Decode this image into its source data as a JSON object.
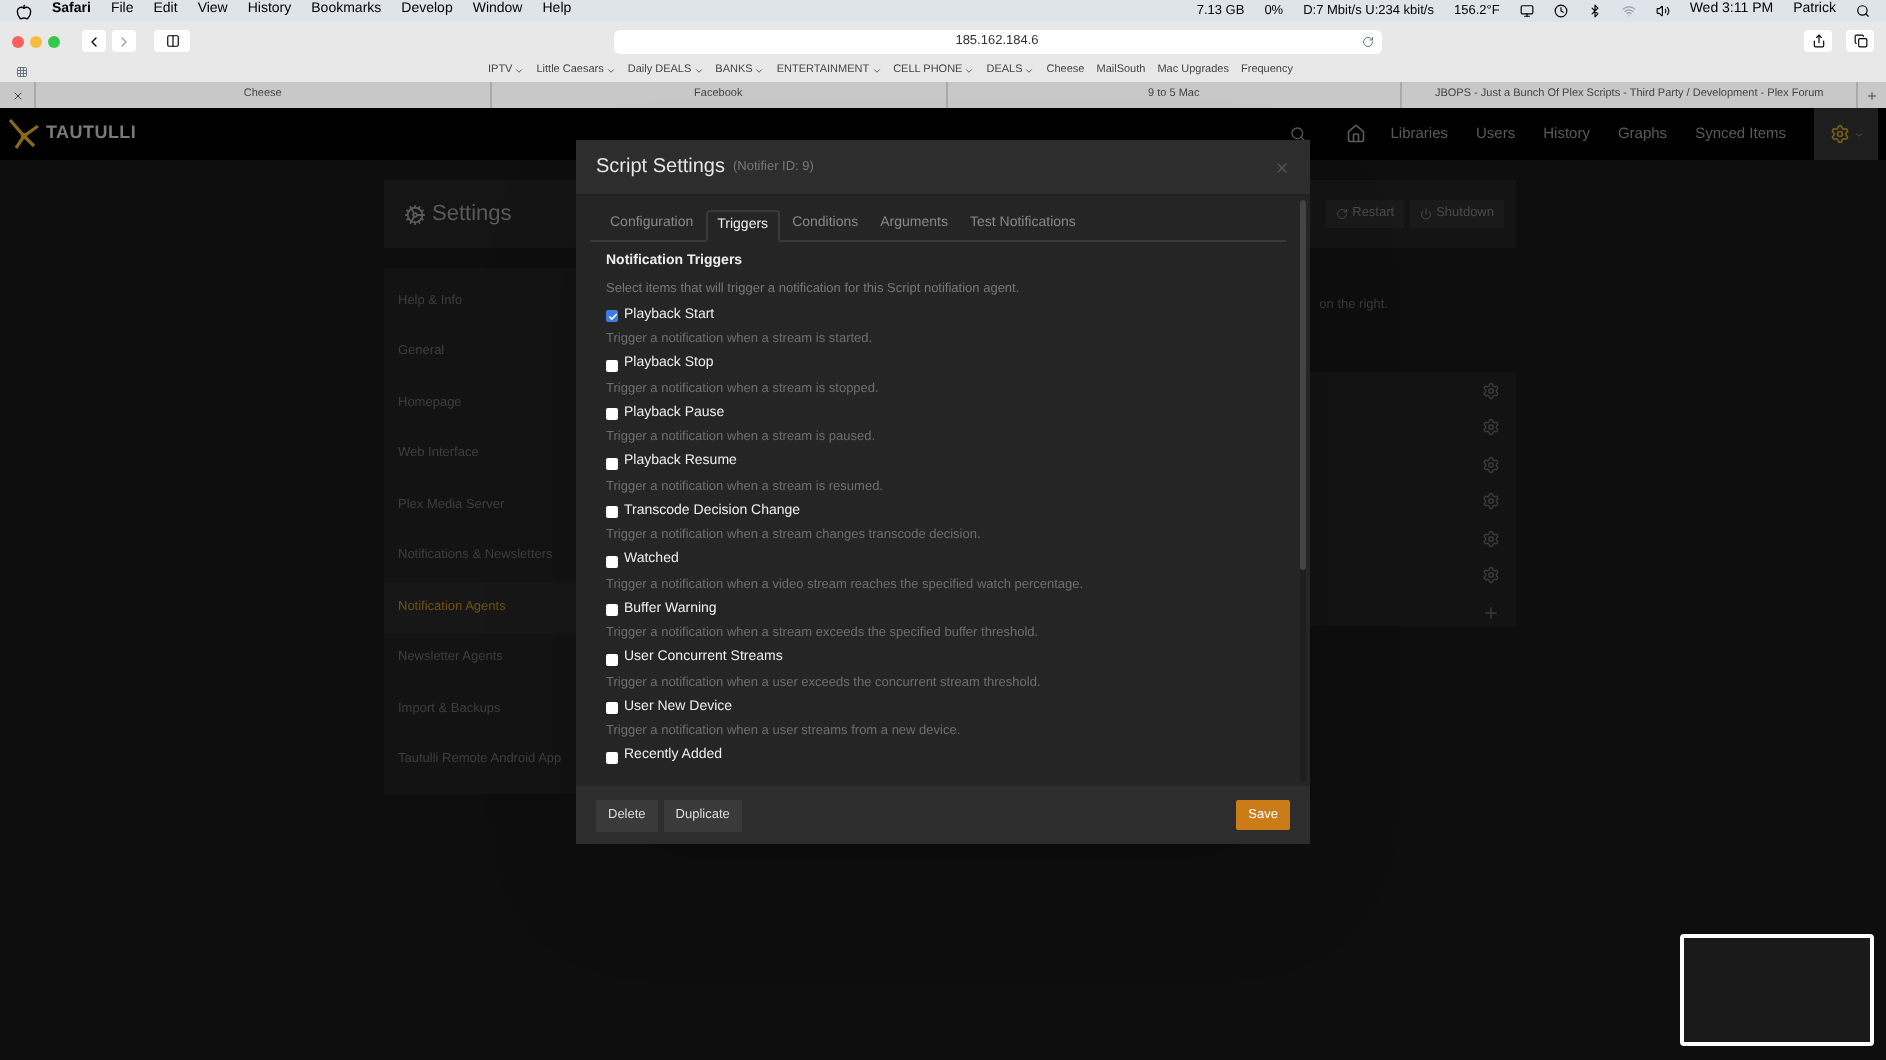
{
  "menu_bar": {
    "app": "Safari",
    "items": [
      "File",
      "Edit",
      "View",
      "History",
      "Bookmarks",
      "Develop",
      "Window",
      "Help"
    ],
    "status": [
      "7.13 GB",
      "0%",
      "D:7 Mbit/s U:234 kbit/s",
      "156.2°F"
    ],
    "clock": "Wed 3:11 PM",
    "user": "Patrick"
  },
  "browser": {
    "url": "185.162.184.6",
    "bookmarks": [
      {
        "label": "IPTV",
        "dropdown": true
      },
      {
        "label": "Little Caesars",
        "dropdown": true
      },
      {
        "label": "Daily DEALS",
        "dropdown": true
      },
      {
        "label": "BANKS",
        "dropdown": true
      },
      {
        "label": "ENTERTAINMENT",
        "dropdown": true
      },
      {
        "label": "CELL PHONE",
        "dropdown": true
      },
      {
        "label": "DEALS",
        "dropdown": true
      },
      {
        "label": "Cheese",
        "dropdown": false
      },
      {
        "label": "MailSouth",
        "dropdown": false
      },
      {
        "label": "Mac Upgrades",
        "dropdown": false
      },
      {
        "label": "Frequency",
        "dropdown": false
      }
    ],
    "tabs": [
      {
        "title": "Cheese",
        "selected": false
      },
      {
        "title": "Facebook",
        "selected": false
      },
      {
        "title": "9 to 5 Mac",
        "selected": false
      },
      {
        "title": "JBOPS - Just a Bunch Of Plex Scripts - Third Party / Development - Plex Forum",
        "selected": false
      }
    ]
  },
  "navbar": {
    "brand": "TAUTULLI",
    "links": [
      "Libraries",
      "Users",
      "History",
      "Graphs",
      "Synced Items"
    ]
  },
  "settings": {
    "title": "Settings",
    "buttons": [
      "Restart",
      "Shutdown"
    ],
    "hint": "on the right.",
    "sidebar": [
      {
        "label": "Help & Info",
        "selected": false
      },
      {
        "label": "General",
        "selected": false
      },
      {
        "label": "Homepage",
        "selected": false
      },
      {
        "label": "Web Interface",
        "selected": false
      },
      {
        "label": "Plex Media Server",
        "selected": false
      },
      {
        "label": "Notifications & Newsletters",
        "selected": false
      },
      {
        "label": "Notification Agents",
        "selected": true
      },
      {
        "label": "Newsletter Agents",
        "selected": false
      },
      {
        "label": "Import & Backups",
        "selected": false
      },
      {
        "label": "Tautulli Remote Android App",
        "selected": false
      }
    ]
  },
  "modal": {
    "title": "Script Settings",
    "subtitle": "(Notifier ID: 9)",
    "tabs": [
      {
        "label": "Configuration",
        "selected": false
      },
      {
        "label": "Triggers",
        "selected": true
      },
      {
        "label": "Conditions",
        "selected": false
      },
      {
        "label": "Arguments",
        "selected": false
      },
      {
        "label": "Test Notifications",
        "selected": false
      }
    ],
    "section_title": "Notification Triggers",
    "section_hint": "Select items that will trigger a notification for this Script notifiation agent.",
    "triggers": [
      {
        "label": "Playback Start",
        "description": "Trigger a notification when a stream is started.",
        "checked": true
      },
      {
        "label": "Playback Stop",
        "description": "Trigger a notification when a stream is stopped.",
        "checked": false
      },
      {
        "label": "Playback Pause",
        "description": "Trigger a notification when a stream is paused.",
        "checked": false
      },
      {
        "label": "Playback Resume",
        "description": "Trigger a notification when a stream is resumed.",
        "checked": false
      },
      {
        "label": "Transcode Decision Change",
        "description": "Trigger a notification when a stream changes transcode decision.",
        "checked": false
      },
      {
        "label": "Watched",
        "description": "Trigger a notification when a video stream reaches the specified watch percentage.",
        "checked": false
      },
      {
        "label": "Buffer Warning",
        "description": "Trigger a notification when a stream exceeds the specified buffer threshold.",
        "checked": false
      },
      {
        "label": "User Concurrent Streams",
        "description": "Trigger a notification when a user exceeds the concurrent stream threshold.",
        "checked": false
      },
      {
        "label": "User New Device",
        "description": "Trigger a notification when a user streams from a new device.",
        "checked": false
      },
      {
        "label": "Recently Added",
        "checked": false
      }
    ],
    "footer_buttons": [
      "Delete",
      "Duplicate"
    ],
    "save": "Save"
  }
}
